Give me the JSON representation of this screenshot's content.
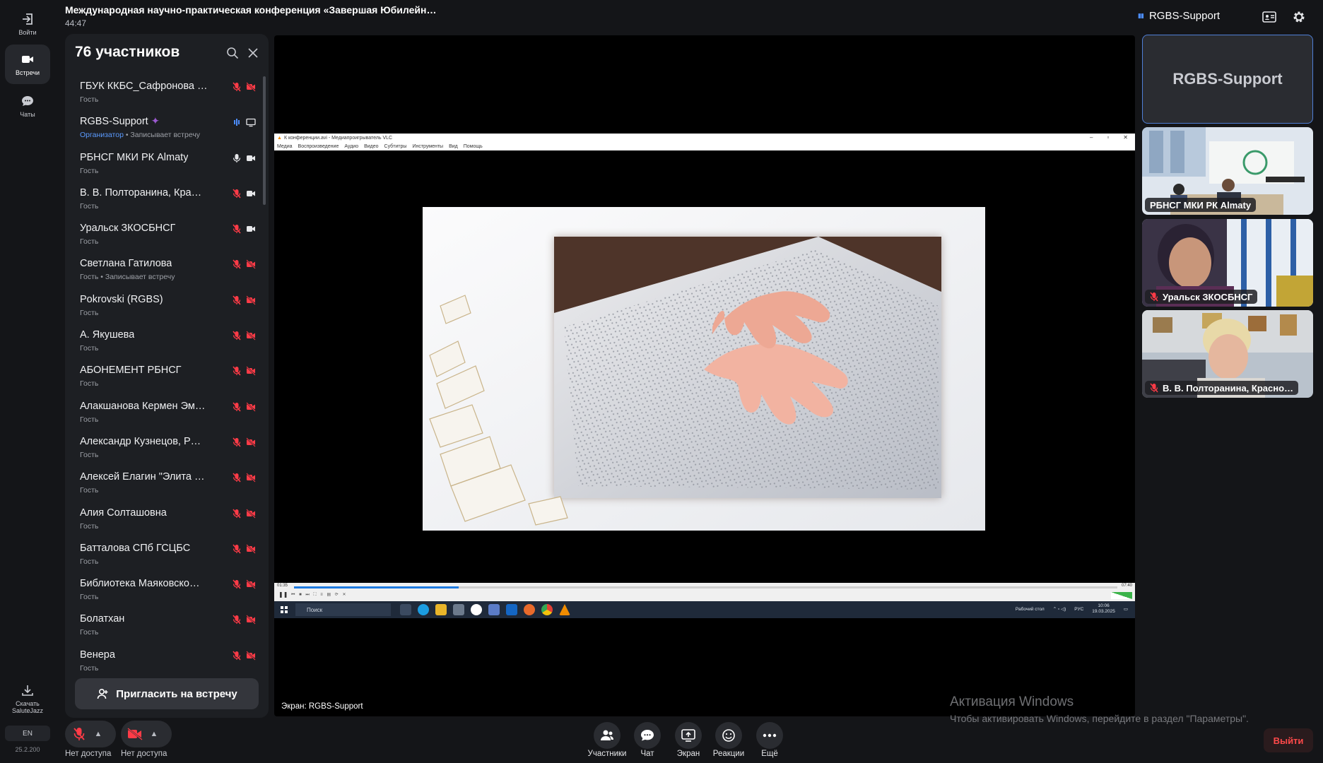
{
  "header": {
    "meeting_title": "Международная научно-практическая конференция «Завершая Юбилейн…",
    "elapsed_time": "44:47",
    "host_name": "RGBS-Support"
  },
  "rail": {
    "items": [
      {
        "label": "Войти",
        "icon": "login-icon"
      },
      {
        "label": "Встречи",
        "icon": "camera-icon"
      },
      {
        "label": "Чаты",
        "icon": "chat-icon"
      }
    ],
    "download_label": "Скачать SaluteJazz",
    "language": "EN",
    "version": "25.2.200"
  },
  "participants": {
    "title": "76 участников",
    "invite_label": "Пригласить на встречу",
    "list": [
      {
        "name": "ГБУК ККБС_Сафронова …",
        "role": "Гость",
        "mic": "off",
        "cam": "off"
      },
      {
        "name": "RGBS-Support",
        "org": "Организатор",
        "role": " • Записывает встречу",
        "mic": "speaking",
        "cam": "screen",
        "star": true
      },
      {
        "name": "РБНСГ МКИ РК Almaty",
        "role": "Гость",
        "mic": "on",
        "cam": "on"
      },
      {
        "name": "В. В. Полторанина, Кра…",
        "role": "Гость",
        "mic": "off",
        "cam": "on"
      },
      {
        "name": "Уральск ЗКОСБНСГ",
        "role": "Гость",
        "mic": "off",
        "cam": "on"
      },
      {
        "name": "Светлана Гатилова",
        "role": "Гость • Записывает встречу",
        "mic": "off",
        "cam": "off"
      },
      {
        "name": "Pokrovski (RGBS)",
        "role": "Гость",
        "mic": "off",
        "cam": "off"
      },
      {
        "name": "А. Якушева",
        "role": "Гость",
        "mic": "off",
        "cam": "off"
      },
      {
        "name": "АБОНЕМЕНТ РБНСГ",
        "role": "Гость",
        "mic": "off",
        "cam": "off"
      },
      {
        "name": "Алакшанова Кермен Эм…",
        "role": "Гость",
        "mic": "off",
        "cam": "off"
      },
      {
        "name": "Александр Кузнецов, Р…",
        "role": "Гость",
        "mic": "off",
        "cam": "off"
      },
      {
        "name": "Алексей Елагин \"Элита …",
        "role": "Гость",
        "mic": "off",
        "cam": "off"
      },
      {
        "name": "Алия Солташовна",
        "role": "Гость",
        "mic": "off",
        "cam": "off"
      },
      {
        "name": "Батталова СПб ГСЦБС",
        "role": "Гость",
        "mic": "off",
        "cam": "off"
      },
      {
        "name": "Библиотека Маяковско…",
        "role": "Гость",
        "mic": "off",
        "cam": "off"
      },
      {
        "name": "Болатхан",
        "role": "Гость",
        "mic": "off",
        "cam": "off"
      },
      {
        "name": "Венера",
        "role": "Гость",
        "mic": "off",
        "cam": "off"
      }
    ]
  },
  "stage": {
    "screen_share_label": "Экран: RGBS-Support",
    "vlc": {
      "window_title": "К конференции.avi - Медиапроигрыватель VLC",
      "menu": [
        "Медиа",
        "Воспроизведение",
        "Аудио",
        "Видео",
        "Субтитры",
        "Инструменты",
        "Вид",
        "Помощь"
      ],
      "time_current": "01:35",
      "time_total": "07:40",
      "progress": 0.2,
      "taskbar_search": "Поиск",
      "tray_desktop": "Рабочий стол",
      "tray_lang": "РУС",
      "tray_time": "10:06",
      "tray_date": "19.03.2025"
    }
  },
  "tiles": {
    "host": "RGBS-Support",
    "cams": [
      {
        "label": "РБНСГ МКИ РК Almaty",
        "muted": false
      },
      {
        "label": "Уральск ЗКОСБНСГ",
        "muted": true
      },
      {
        "label": "В. В. Полторанина, Красно…",
        "muted": true
      }
    ]
  },
  "controls": {
    "mic_label": "Нет доступа",
    "cam_label": "Нет доступа",
    "tools": [
      {
        "label": "Участники",
        "icon": "participants-icon"
      },
      {
        "label": "Чат",
        "icon": "chat-icon"
      },
      {
        "label": "Экран",
        "icon": "screen-share-icon"
      },
      {
        "label": "Реакции",
        "icon": "reactions-icon"
      },
      {
        "label": "Ещё",
        "icon": "more-icon"
      }
    ],
    "leave_label": "Выйти"
  },
  "watermark": {
    "line1": "Активация Windows",
    "line2": "Чтобы активировать Windows, перейдите в раздел \"Параметры\"."
  },
  "colors": {
    "accent": "#4c8dff",
    "muted_red": "#ff3b47",
    "leave_red": "#ff4a4a"
  }
}
